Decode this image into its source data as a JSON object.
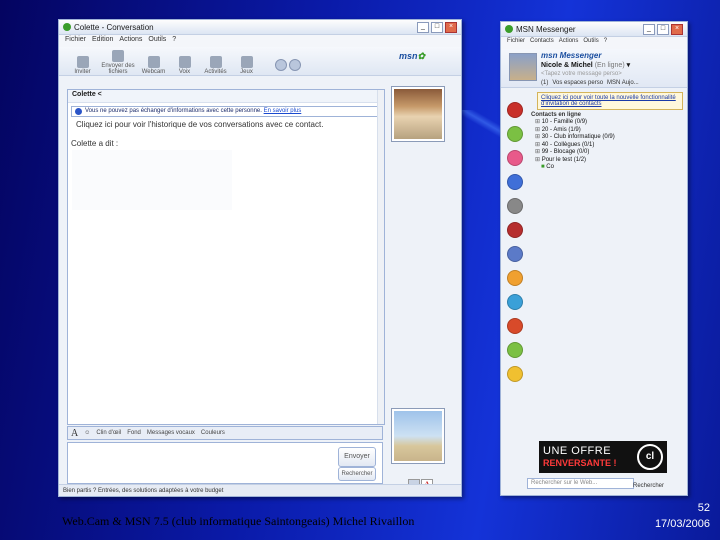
{
  "conversation": {
    "title": "Colette - Conversation",
    "menu": [
      "Fichier",
      "Edition",
      "Actions",
      "Outils",
      "?"
    ],
    "tools": [
      "Inviter",
      "Envoyer des fichiers",
      "Webcam",
      "Voix",
      "Activités",
      "Jeux"
    ],
    "logo": "msn",
    "to_label": "Colette <",
    "info_text": "Vous ne pouvez pas échanger d'informations avec cette personne.",
    "info_link": "En savoir plus",
    "history_link": "Cliquez ici pour voir l'historique de vos conversations avec ce contact.",
    "said_label": "Colette a dit :",
    "format_items": [
      "Clin d'œil",
      "Fond",
      "Messages vocaux",
      "Couleurs"
    ],
    "send_button": "Envoyer",
    "search_button": "Rechercher",
    "status_bar": "Bien partis ? Entrées, des solutions adaptées à votre budget"
  },
  "messenger": {
    "title": "MSN Messenger",
    "menu": [
      "Fichier",
      "Contacts",
      "Actions",
      "Outils",
      "?"
    ],
    "logo": "msn Messenger",
    "user_name": "Nicole & Michel",
    "user_status": "(En ligne)",
    "personal_message": "<Tapez votre message perso>",
    "quick_links": [
      "(1)",
      "Vos espaces perso",
      "MSN Aujo..."
    ],
    "notice": "Cliquez ici pour voir toute la nouvelle fonctionnalité d'invitation de contacts",
    "online_header": "Contacts en ligne",
    "groups": [
      "10 - Famille (0/9)",
      "20 - Amis (1/9)",
      "30 - Club informatique (0/9)",
      "40 - Collègues (0/1)",
      "99 - Blocage (0/0)",
      "Pour le test (1/2)"
    ],
    "contacts": [
      "Co"
    ],
    "ad_line1": "UNE OFFRE",
    "ad_line2": "RENVERSANTE !",
    "ad_logo": "cl",
    "search_placeholder": "Rechercher sur le Web...",
    "search_go": "Rechercher"
  },
  "footer": {
    "caption": "Web.Cam & MSN 7.5 (club informatique Saintongeais)  Michel Rivaillon",
    "page": "52",
    "date": "17/03/2006"
  },
  "colors": {
    "background": "#0a1aa8",
    "window": "#eef2f8",
    "ad_red": "#ff3a3a"
  }
}
